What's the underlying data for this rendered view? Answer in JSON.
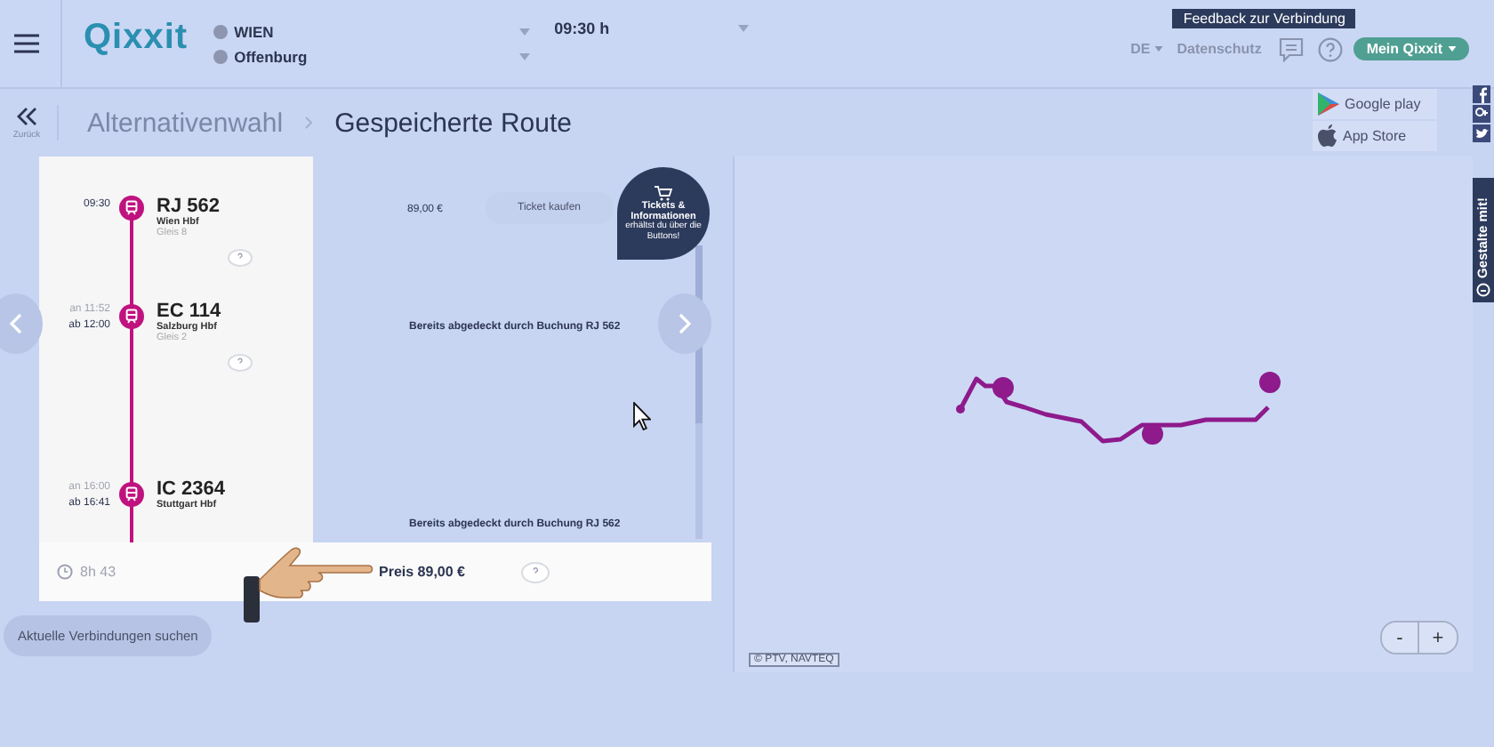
{
  "header": {
    "logo": "Qixxit",
    "route": {
      "from": "WIEN",
      "to": "Offenburg"
    },
    "time": "09:30 h",
    "language": "DE",
    "privacy_link": "Datenschutz",
    "tooltip": "Feedback zur Verbindung",
    "account_button": "Mein Qixxit"
  },
  "breadcrumb": {
    "back_label": "Zurück",
    "items": [
      {
        "label": "Alternativenwahl",
        "selected": false
      },
      {
        "label": "Gespeicherte Route",
        "selected": true
      }
    ]
  },
  "store_badges": [
    {
      "kind": "google",
      "label": "Google play"
    },
    {
      "kind": "apple",
      "label": "App Store"
    }
  ],
  "legs": [
    {
      "times": [
        "09:30"
      ],
      "train": "RJ 562",
      "station": "Wien Hbf",
      "platform": "Gleis 8",
      "kind": "ticket",
      "price": "89,00 €",
      "button": "Ticket kaufen"
    },
    {
      "times": [
        "an 11:52",
        "ab 12:00"
      ],
      "train": "EC 114",
      "station": "Salzburg Hbf",
      "platform": "Gleis 2",
      "kind": "covered",
      "note": "Bereits abgedeckt durch Buchung RJ 562"
    },
    {
      "times": [
        "an 16:00",
        "ab 16:41"
      ],
      "train": "IC 2364",
      "station": "Stuttgart Hbf",
      "kind": "covered",
      "note": "Bereits abgedeckt durch Buchung RJ 562"
    }
  ],
  "help_bubble": {
    "title": "Tickets & Informationen",
    "text": "erhältst du über die Buttons!"
  },
  "summary": {
    "duration": "8h 43",
    "price": "Preis 89,00 €"
  },
  "search_button": "Aktuelle Verbindungen suchen",
  "map": {
    "attribution": "© PTV, NAVTEQ",
    "zoom_out": "-",
    "zoom_in": "+"
  },
  "feedback_tab": "Gestalte mit!"
}
